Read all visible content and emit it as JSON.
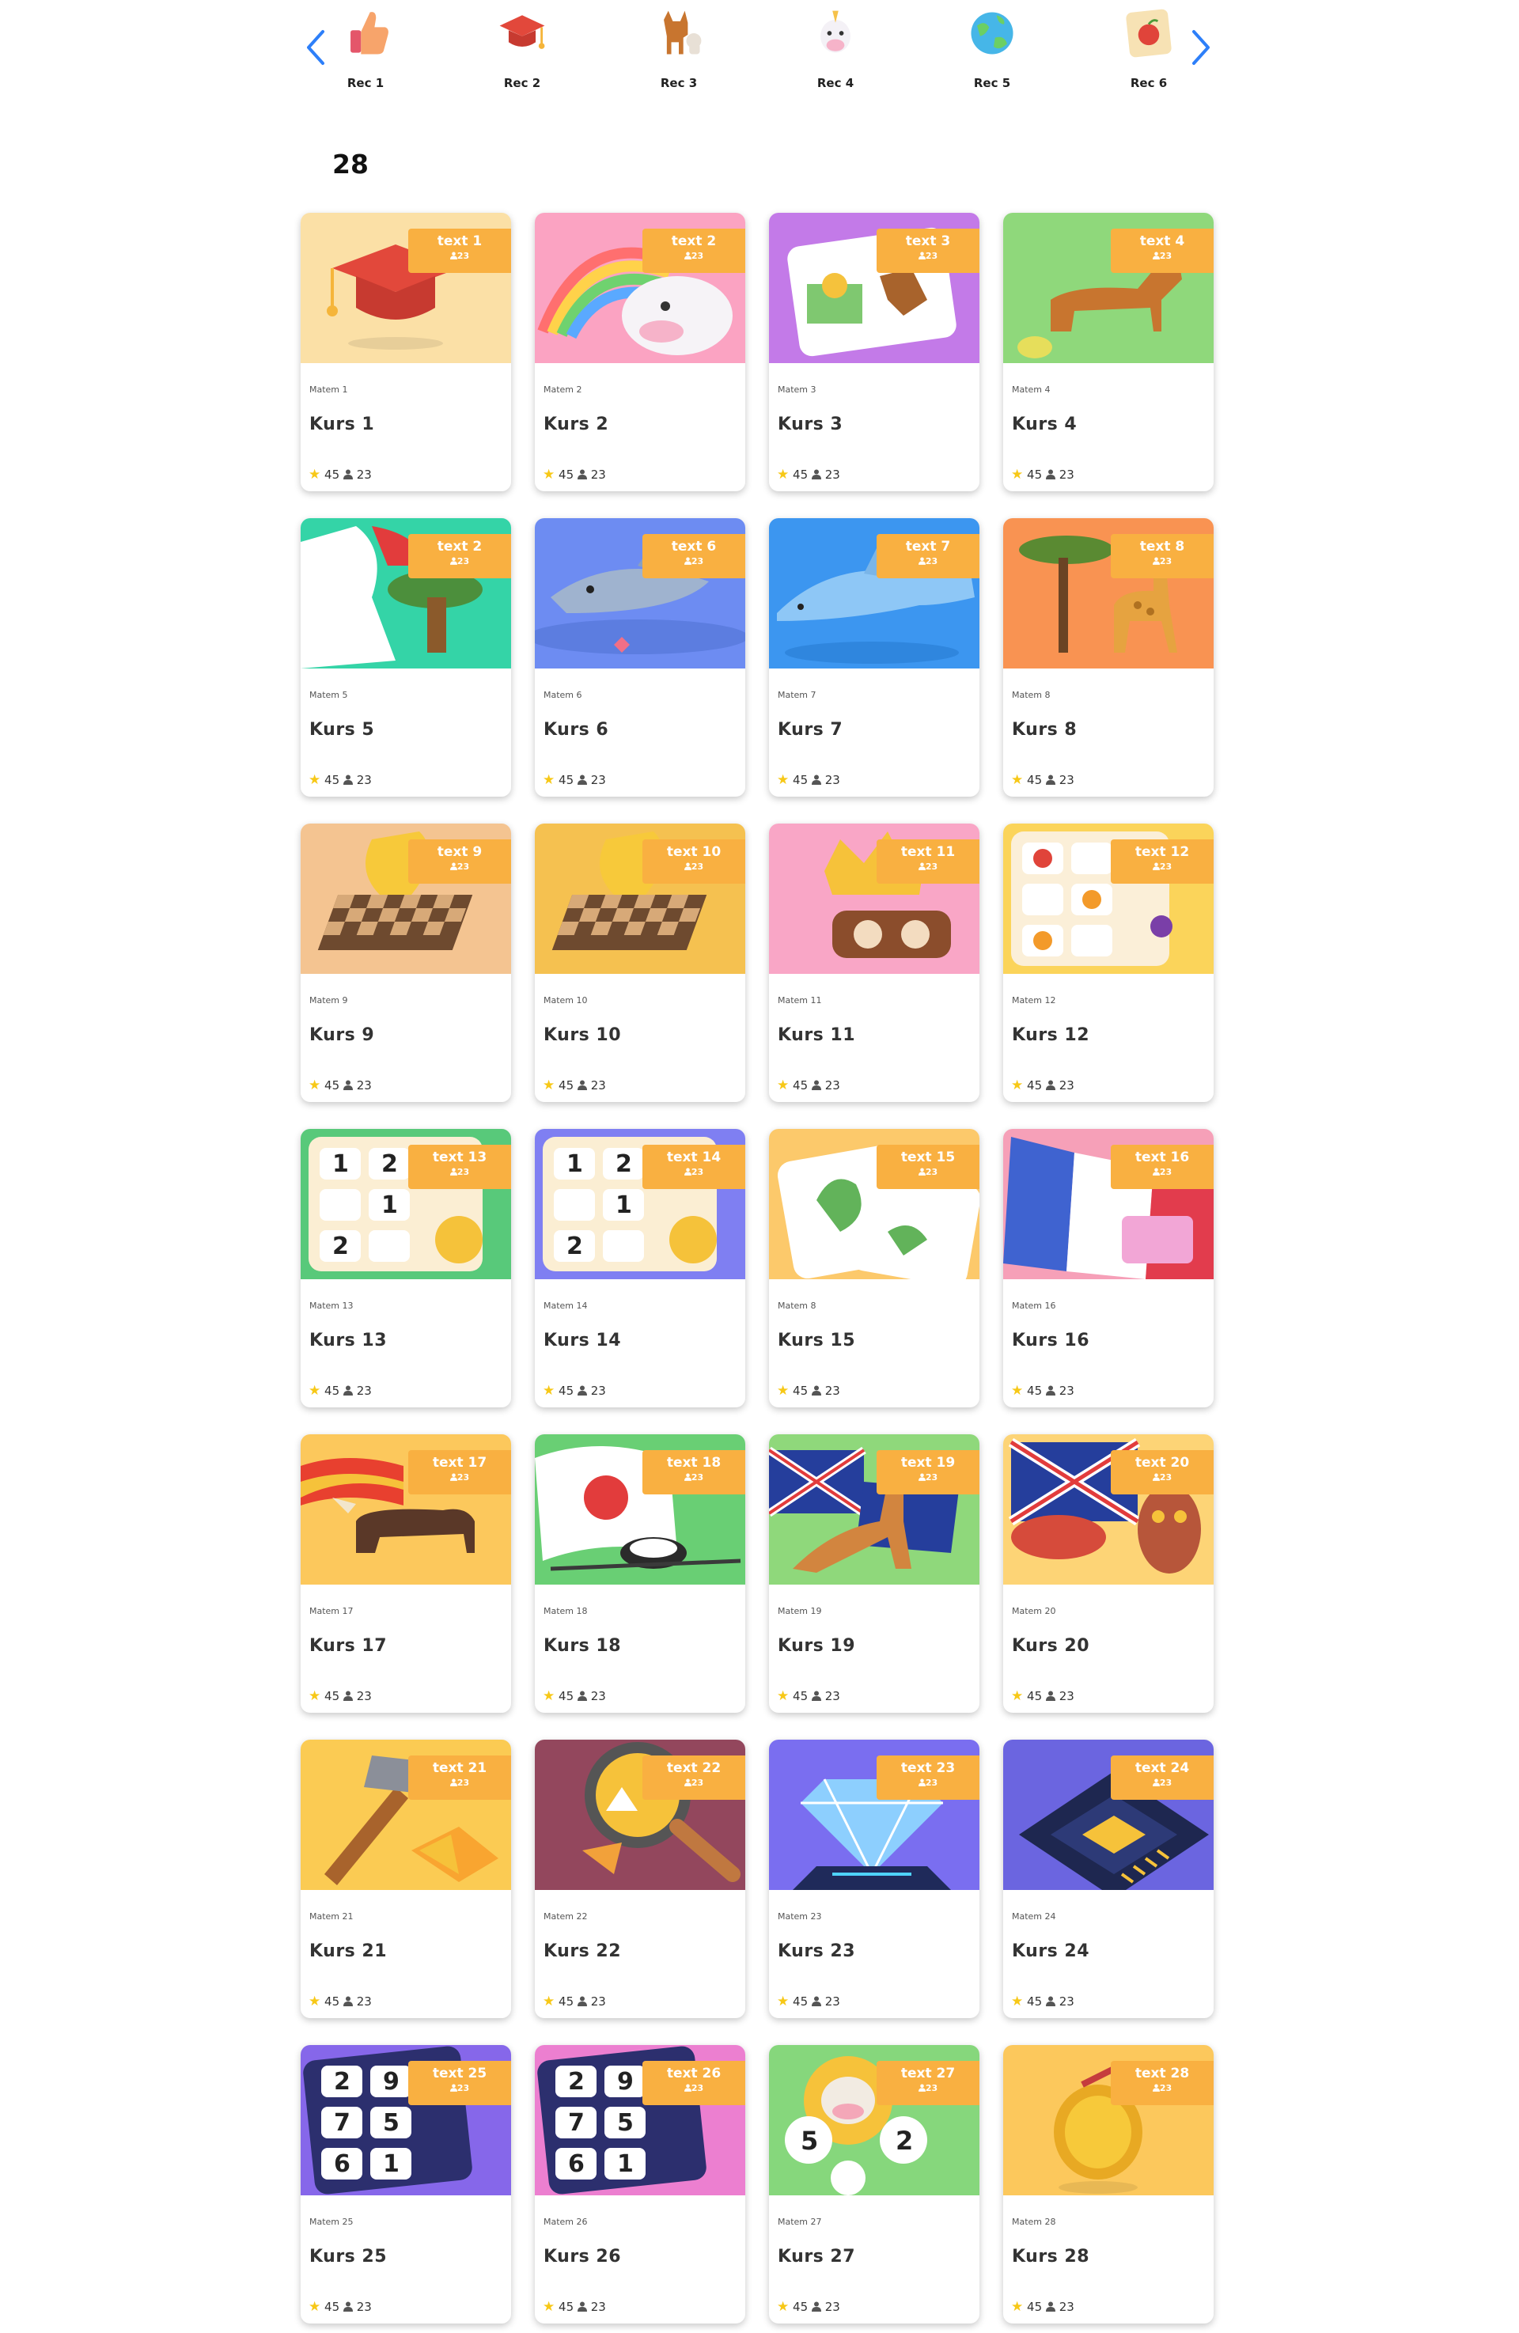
{
  "recommendations": {
    "prev_label": "previous",
    "next_label": "next",
    "items": [
      {
        "label": "Rec 1",
        "icon": "thumbs-up-icon"
      },
      {
        "label": "Rec 2",
        "icon": "graduation-cap-icon"
      },
      {
        "label": "Rec 3",
        "icon": "dog-cat-icon"
      },
      {
        "label": "Rec 4",
        "icon": "unicorn-icon"
      },
      {
        "label": "Rec 5",
        "icon": "globe-icon"
      },
      {
        "label": "Rec 6",
        "icon": "fruit-card-icon"
      }
    ]
  },
  "course_count": "28",
  "courses": [
    {
      "badge": "text 1",
      "badge_count": "23",
      "subject": "Matem 1",
      "title": "Kurs 1",
      "rating": "45",
      "learners": "23",
      "bg": "#fbe0a6",
      "art": "graduation-cap"
    },
    {
      "badge": "text 2",
      "badge_count": "23",
      "subject": "Matem 2",
      "title": "Kurs 2",
      "rating": "45",
      "learners": "23",
      "bg": "#fba3c2",
      "art": "unicorn"
    },
    {
      "badge": "text 3",
      "badge_count": "23",
      "subject": "Matem 3",
      "title": "Kurs 3",
      "rating": "45",
      "learners": "23",
      "bg": "#c37ae8",
      "art": "horse-card"
    },
    {
      "badge": "text 4",
      "badge_count": "23",
      "subject": "Matem 4",
      "title": "Kurs 4",
      "rating": "45",
      "learners": "23",
      "bg": "#8fd87b",
      "art": "dog"
    },
    {
      "badge": "text 2",
      "badge_count": "23",
      "subject": "Matem 5",
      "title": "Kurs 5",
      "rating": "45",
      "learners": "23",
      "bg": "#34d4a7",
      "art": "flag-tree"
    },
    {
      "badge": "text 6",
      "badge_count": "23",
      "subject": "Matem 6",
      "title": "Kurs 6",
      "rating": "45",
      "learners": "23",
      "bg": "#6d8cf2",
      "art": "shark"
    },
    {
      "badge": "text 7",
      "badge_count": "23",
      "subject": "Matem 7",
      "title": "Kurs 7",
      "rating": "45",
      "learners": "23",
      "bg": "#3c96f0",
      "art": "dolphin"
    },
    {
      "badge": "text 8",
      "badge_count": "23",
      "subject": "Matem 8",
      "title": "Kurs 8",
      "rating": "45",
      "learners": "23",
      "bg": "#f99352",
      "art": "giraffe"
    },
    {
      "badge": "text 9",
      "badge_count": "23",
      "subject": "Matem 9",
      "title": "Kurs 9",
      "rating": "45",
      "learners": "23",
      "bg": "#f4c491",
      "art": "chessboard"
    },
    {
      "badge": "text 10",
      "badge_count": "23",
      "subject": "Matem 10",
      "title": "Kurs 10",
      "rating": "45",
      "learners": "23",
      "bg": "#f5c150",
      "art": "chessboard"
    },
    {
      "badge": "text 11",
      "badge_count": "23",
      "subject": "Matem 11",
      "title": "Kurs 11",
      "rating": "45",
      "learners": "23",
      "bg": "#f9a6c6",
      "art": "crown-clock"
    },
    {
      "badge": "text 12",
      "badge_count": "23",
      "subject": "Matem 12",
      "title": "Kurs 12",
      "rating": "45",
      "learners": "23",
      "bg": "#fbd45a",
      "art": "fruit-tiles"
    },
    {
      "badge": "text 13",
      "badge_count": "23",
      "subject": "Matem 13",
      "title": "Kurs 13",
      "rating": "45",
      "learners": "23",
      "bg": "#58c97a",
      "art": "number-grid"
    },
    {
      "badge": "text 14",
      "badge_count": "23",
      "subject": "Matem 14",
      "title": "Kurs 14",
      "rating": "45",
      "learners": "23",
      "bg": "#7f7ff2",
      "art": "number-grid"
    },
    {
      "badge": "text 15",
      "badge_count": "23",
      "subject": "Matem 8",
      "title": "Kurs 15",
      "rating": "45",
      "learners": "23",
      "bg": "#fcc96b",
      "art": "cactus-cards"
    },
    {
      "badge": "text 16",
      "badge_count": "23",
      "subject": "Matem 16",
      "title": "Kurs 16",
      "rating": "45",
      "learners": "23",
      "bg": "#f6a0b8",
      "art": "france-flag"
    },
    {
      "badge": "text 17",
      "badge_count": "23",
      "subject": "Matem 17",
      "title": "Kurs 17",
      "rating": "45",
      "learners": "23",
      "bg": "#fcc85c",
      "art": "bull"
    },
    {
      "badge": "text 18",
      "badge_count": "23",
      "subject": "Matem 18",
      "title": "Kurs 18",
      "rating": "45",
      "learners": "23",
      "bg": "#69cf74",
      "art": "japan-sushi"
    },
    {
      "badge": "text 19",
      "badge_count": "23",
      "subject": "Matem 19",
      "title": "Kurs 19",
      "rating": "45",
      "learners": "23",
      "bg": "#8fd87b",
      "art": "kangaroo"
    },
    {
      "badge": "text 20",
      "badge_count": "23",
      "subject": "Matem 20",
      "title": "Kurs 20",
      "rating": "45",
      "learners": "23",
      "bg": "#fdd476",
      "art": "uk-mask"
    },
    {
      "badge": "text 21",
      "badge_count": "23",
      "subject": "Matem 21",
      "title": "Kurs 21",
      "rating": "45",
      "learners": "23",
      "bg": "#fbcb53",
      "art": "hammer-gem"
    },
    {
      "badge": "text 22",
      "badge_count": "23",
      "subject": "Matem 22",
      "title": "Kurs 22",
      "rating": "45",
      "learners": "23",
      "bg": "#93475d",
      "art": "magnifier"
    },
    {
      "badge": "text 23",
      "badge_count": "23",
      "subject": "Matem 23",
      "title": "Kurs 23",
      "rating": "45",
      "learners": "23",
      "bg": "#7a6ef0",
      "art": "diamond"
    },
    {
      "badge": "text 24",
      "badge_count": "23",
      "subject": "Matem 24",
      "title": "Kurs 24",
      "rating": "45",
      "learners": "23",
      "bg": "#6b65e0",
      "art": "chip"
    },
    {
      "badge": "text 25",
      "badge_count": "23",
      "subject": "Matem 25",
      "title": "Kurs 25",
      "rating": "45",
      "learners": "23",
      "bg": "#8667ea",
      "art": "number-keypad"
    },
    {
      "badge": "text 26",
      "badge_count": "23",
      "subject": "Matem 26",
      "title": "Kurs 26",
      "rating": "45",
      "learners": "23",
      "bg": "#ec7fd0",
      "art": "number-keypad"
    },
    {
      "badge": "text 27",
      "badge_count": "23",
      "subject": "Matem 27",
      "title": "Kurs 27",
      "rating": "45",
      "learners": "23",
      "bg": "#86d77c",
      "art": "cow-numbers"
    },
    {
      "badge": "text 28",
      "badge_count": "23",
      "subject": "Matem 28",
      "title": "Kurs 28",
      "rating": "45",
      "learners": "23",
      "bg": "#fcc85c",
      "art": "gold-coin"
    }
  ],
  "colors": {
    "accent": "#f9b041",
    "nav_arrow": "#2d7ff9",
    "star": "#f7c817"
  }
}
